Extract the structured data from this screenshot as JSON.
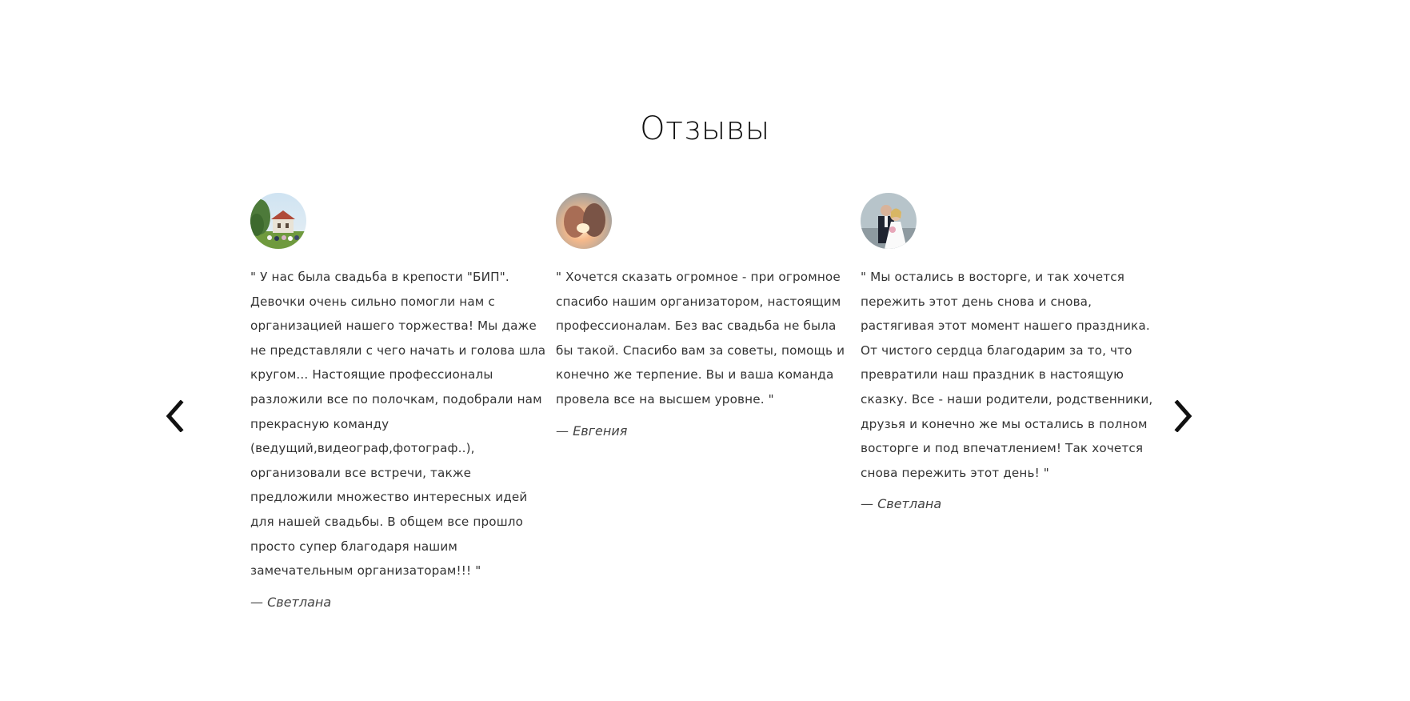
{
  "section": {
    "title": "Отзывы"
  },
  "navigation": {
    "prev_icon": "chevron-left-icon",
    "next_icon": "chevron-right-icon"
  },
  "reviews": [
    {
      "avatar_icon": "wedding-fortress-photo",
      "quote": "\" У нас была свадьба в крепости \"БИП\". Девочки очень сильно помогли нам с организацией нашего торжества! Мы даже не представляли с чего начать и голова шла кругом... Настоящие профессионалы разложили все по полочкам, подобрали нам прекрасную команду (ведущий,видеограф,фотограф..), организовали все встречи, также предложили множество интересных идей для нашей свадьбы. В общем все прошло просто супер благодаря нашим замечательным организаторам!!! \"",
      "author": "— Светлана"
    },
    {
      "avatar_icon": "couple-sunset-photo",
      "quote": "\" Хочется сказать огромное - при огромное спасибо нашим организатором, настоящим профессионалам. Без вас свадьба не была бы такой. Спасибо вам за советы, помощь и конечно же терпение. Вы и ваша команда провела все на высшем уровне. \"",
      "author": "— Евгения"
    },
    {
      "avatar_icon": "bride-groom-photo",
      "quote": "\" Мы остались в восторге, и так хочется пережить этот день снова и снова, растягивая этот момент нашего праздника. От чистого сердца благодарим за то, что превратили наш праздник в настоящую сказку. Все - наши родители, родственники, друзья и конечно же мы остались в полном восторге и под впечатлением! Так хочется снова пережить этот день! \"",
      "author": "— Светлана"
    }
  ]
}
